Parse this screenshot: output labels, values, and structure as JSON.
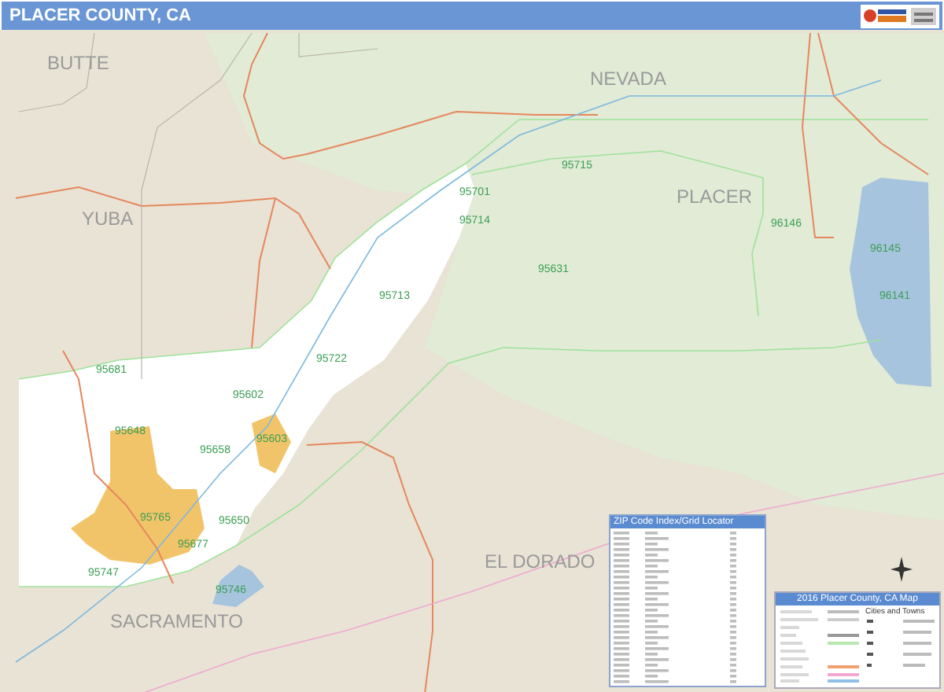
{
  "header": {
    "title": "PLACER COUNTY, CA"
  },
  "map": {
    "county_labels": [
      {
        "text": "BUTTE"
      },
      {
        "text": "YUBA"
      },
      {
        "text": "NEVADA"
      },
      {
        "text": "PLACER"
      },
      {
        "text": "EL DORADO"
      },
      {
        "text": "SACRAMENTO"
      }
    ],
    "zip_labels": [
      {
        "text": "95715"
      },
      {
        "text": "95701"
      },
      {
        "text": "95714"
      },
      {
        "text": "95713"
      },
      {
        "text": "95631"
      },
      {
        "text": "96146"
      },
      {
        "text": "96145"
      },
      {
        "text": "96141"
      },
      {
        "text": "95681"
      },
      {
        "text": "95602"
      },
      {
        "text": "95722"
      },
      {
        "text": "95603"
      },
      {
        "text": "95648"
      },
      {
        "text": "95658"
      },
      {
        "text": "95765"
      },
      {
        "text": "95650"
      },
      {
        "text": "95677"
      },
      {
        "text": "95747"
      },
      {
        "text": "95746"
      }
    ]
  },
  "zip_index": {
    "title": "ZIP Code Index/Grid Locator"
  },
  "legend": {
    "title": "2016 Placer County, CA Map",
    "subtitle": "Cities and Towns"
  }
}
